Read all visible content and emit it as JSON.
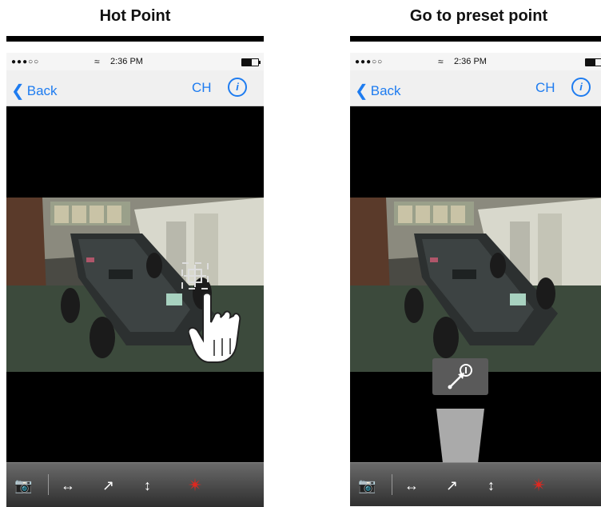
{
  "panels": [
    {
      "heading": "Hot Point",
      "status": {
        "signal": "●●●○○",
        "time": "2:36 PM"
      },
      "nav": {
        "back_label": "Back",
        "channel_label": "CH",
        "info_label": "i"
      }
    },
    {
      "heading": "Go to preset point",
      "status": {
        "signal": "●●●○○",
        "time": "2:36 PM"
      },
      "nav": {
        "back_label": "Back",
        "channel_label": "CH",
        "info_label": "i"
      }
    }
  ],
  "toolbar": {
    "icons": [
      "snapshot-icon",
      "ptz-horizontal-icon",
      "preset-point-icon",
      "ptz-vertical-icon",
      "ptz-control-icon"
    ],
    "accent_color": "#e0271f"
  },
  "colors": {
    "ios_blue": "#1e7cf0",
    "rule": "#000000"
  }
}
